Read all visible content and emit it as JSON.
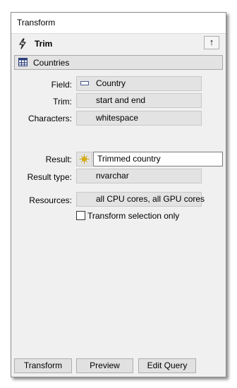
{
  "window": {
    "title": "Transform"
  },
  "header": {
    "title": "Trim",
    "up_button": "↑"
  },
  "source": {
    "label": "Countries"
  },
  "fields": {
    "field": {
      "label": "Field:",
      "value": "Country"
    },
    "trim": {
      "label": "Trim:",
      "value": "start and end"
    },
    "characters": {
      "label": "Characters:",
      "value": "whitespace"
    },
    "result": {
      "label": "Result:",
      "value": "Trimmed country"
    },
    "result_type": {
      "label": "Result type:",
      "value": "nvarchar"
    },
    "resources": {
      "label": "Resources:",
      "value": "all CPU cores, all GPU cores"
    }
  },
  "options": {
    "transform_selection_only": {
      "label": "Transform selection only",
      "checked": false
    }
  },
  "buttons": {
    "transform": "Transform",
    "preview": "Preview",
    "edit_query": "Edit Query"
  },
  "icons": [
    "bolt-icon",
    "table-icon",
    "field-icon",
    "result-field-icon"
  ],
  "colors": {
    "panel_bg": "#f0f0f0",
    "box_bg": "#e3e3e3",
    "result_icon": "#f2d033"
  }
}
